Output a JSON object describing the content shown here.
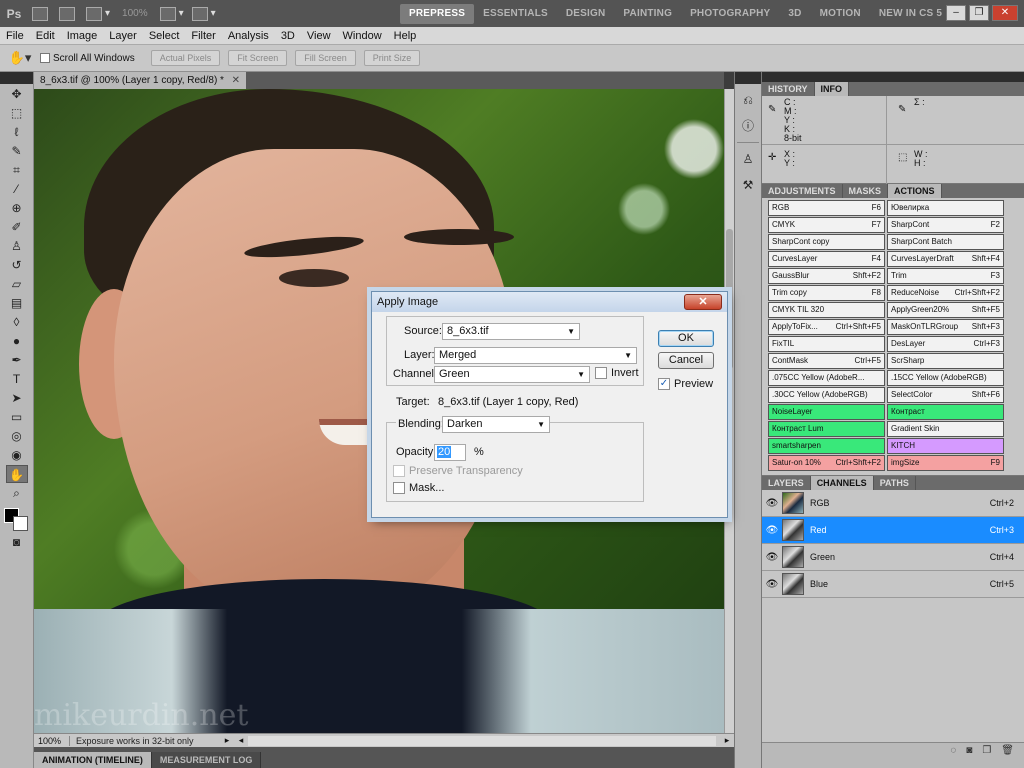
{
  "appbar": {
    "logo": "Ps",
    "zoom": "100%",
    "workspaces": [
      "PREPRESS",
      "ESSENTIALS",
      "DESIGN",
      "PAINTING",
      "PHOTOGRAPHY",
      "3D",
      "MOTION",
      "NEW IN CS 5",
      "»"
    ],
    "active_workspace": "PREPRESS"
  },
  "menubar": [
    "File",
    "Edit",
    "Image",
    "Layer",
    "Select",
    "Filter",
    "Analysis",
    "3D",
    "View",
    "Window",
    "Help"
  ],
  "options": {
    "scroll_all_windows": "Scroll All Windows",
    "buttons": [
      "Actual Pixels",
      "Fit Screen",
      "Fill Screen",
      "Print Size"
    ]
  },
  "document": {
    "tab_title": "8_6x3.tif @ 100% (Layer 1 copy, Red/8) *",
    "watermark": "mikeurdin.net"
  },
  "status": {
    "zoom": "100%",
    "message": "Exposure works in 32-bit only"
  },
  "bottom_tabs": [
    "ANIMATION (TIMELINE)",
    "MEASUREMENT LOG"
  ],
  "panel_tabs_top": [
    "HISTORY",
    "INFO"
  ],
  "info": {
    "left_top": [
      "C :",
      "M :",
      "Y :",
      "K :",
      "8-bit"
    ],
    "left_bottom": [
      "X :",
      "Y :"
    ],
    "right_top": [
      "Σ :"
    ],
    "right_bottom": [
      "W :",
      "H :"
    ]
  },
  "panel_tabs_mid": [
    "ADJUSTMENTS",
    "MASKS",
    "ACTIONS"
  ],
  "actions": [
    {
      "name": "RGB",
      "key": "F6",
      "color": ""
    },
    {
      "name": "Ювелирка",
      "key": "",
      "color": ""
    },
    {
      "name": "CMYK",
      "key": "F7",
      "color": ""
    },
    {
      "name": "SharpCont",
      "key": "F2",
      "color": ""
    },
    {
      "name": "SharpCont copy",
      "key": "",
      "color": ""
    },
    {
      "name": "SharpCont Batch",
      "key": "",
      "color": ""
    },
    {
      "name": "CurvesLayer",
      "key": "F4",
      "color": ""
    },
    {
      "name": "CurvesLayerDraft",
      "key": "Shft+F4",
      "color": ""
    },
    {
      "name": "GaussBlur",
      "key": "Shft+F2",
      "color": ""
    },
    {
      "name": "Trim",
      "key": "F3",
      "color": ""
    },
    {
      "name": "Trim copy",
      "key": "F8",
      "color": ""
    },
    {
      "name": "ReduceNoise",
      "key": "Ctrl+Shft+F2",
      "color": ""
    },
    {
      "name": "CMYK TIL 320",
      "key": "",
      "color": ""
    },
    {
      "name": "ApplyGreen20%",
      "key": "Shft+F5",
      "color": ""
    },
    {
      "name": "ApplyToFix...",
      "key": "Ctrl+Shft+F5",
      "color": ""
    },
    {
      "name": "MaskOnTLRGroup",
      "key": "Shft+F3",
      "color": ""
    },
    {
      "name": "FixTIL",
      "key": "",
      "color": ""
    },
    {
      "name": "DesLayer",
      "key": "Ctrl+F3",
      "color": ""
    },
    {
      "name": "ContMask",
      "key": "Ctrl+F5",
      "color": ""
    },
    {
      "name": "ScrSharp",
      "key": "",
      "color": ""
    },
    {
      "name": ".075CC Yellow (AdobeR...",
      "key": "",
      "color": ""
    },
    {
      "name": ".15CC Yellow (AdobeRGB)",
      "key": "",
      "color": ""
    },
    {
      "name": ".30CC Yellow (AdobeRGB)",
      "key": "",
      "color": ""
    },
    {
      "name": "SelectColor",
      "key": "Shft+F6",
      "color": ""
    },
    {
      "name": "NoiseLayer",
      "key": "",
      "color": "green"
    },
    {
      "name": "Контраст",
      "key": "",
      "color": "green"
    },
    {
      "name": "Контраст Lum",
      "key": "",
      "color": "green"
    },
    {
      "name": "Gradient Skin",
      "key": "",
      "color": ""
    },
    {
      "name": "smartsharpen",
      "key": "",
      "color": "green"
    },
    {
      "name": "KITCH",
      "key": "",
      "color": "purple"
    },
    {
      "name": "Satur-on 10%",
      "key": "Ctrl+Shft+F2",
      "color": "red"
    },
    {
      "name": "imgSize",
      "key": "F9",
      "color": "red"
    }
  ],
  "panel_tabs_bottom": [
    "LAYERS",
    "CHANNELS",
    "PATHS"
  ],
  "channels": [
    {
      "name": "RGB",
      "shortcut": "Ctrl+2",
      "selected": false
    },
    {
      "name": "Red",
      "shortcut": "Ctrl+3",
      "selected": true
    },
    {
      "name": "Green",
      "shortcut": "Ctrl+4",
      "selected": false
    },
    {
      "name": "Blue",
      "shortcut": "Ctrl+5",
      "selected": false
    }
  ],
  "dialog": {
    "title": "Apply Image",
    "close": "✕",
    "source_label": "Source:",
    "source_value": "8_6x3.tif",
    "layer_label": "Layer:",
    "layer_value": "Merged",
    "channel_label": "Channel:",
    "channel_value": "Green",
    "invert_label": "Invert",
    "target_label": "Target:",
    "target_value": "8_6x3.tif (Layer 1 copy, Red)",
    "blending_label": "Blending:",
    "blending_value": "Darken",
    "opacity_label": "Opacity:",
    "opacity_value": "20",
    "opacity_unit": "%",
    "preserve_label": "Preserve Transparency",
    "mask_label": "Mask...",
    "ok": "OK",
    "cancel": "Cancel",
    "preview_label": "Preview"
  }
}
